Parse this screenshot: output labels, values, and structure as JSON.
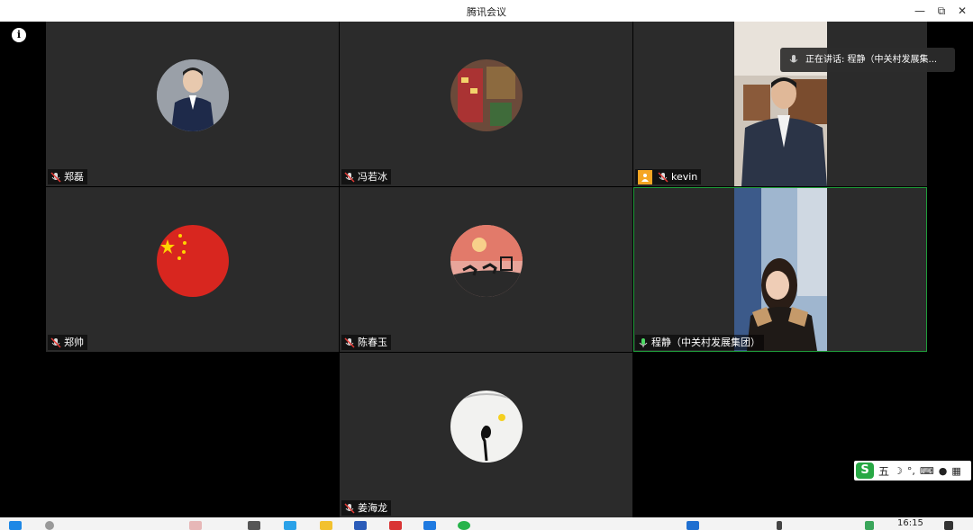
{
  "window": {
    "title": "腾讯会议"
  },
  "participants": [
    {
      "name": "郑磊"
    },
    {
      "name": "冯若冰"
    },
    {
      "name": "kevin"
    },
    {
      "name": "郑帅"
    },
    {
      "name": "陈春玉"
    },
    {
      "name": "程静（中关村发展集团）"
    },
    {
      "name": "姜海龙"
    }
  ],
  "speaking": {
    "label": "正在讲话: 程静（中关村发展集..."
  },
  "ime": {
    "label": "五"
  },
  "taskbar": {
    "time": "16:15"
  },
  "colors": {
    "active_border": "#1f9d3a",
    "tile_bg": "#2b2b2b",
    "host_badge": "#f5a623"
  }
}
